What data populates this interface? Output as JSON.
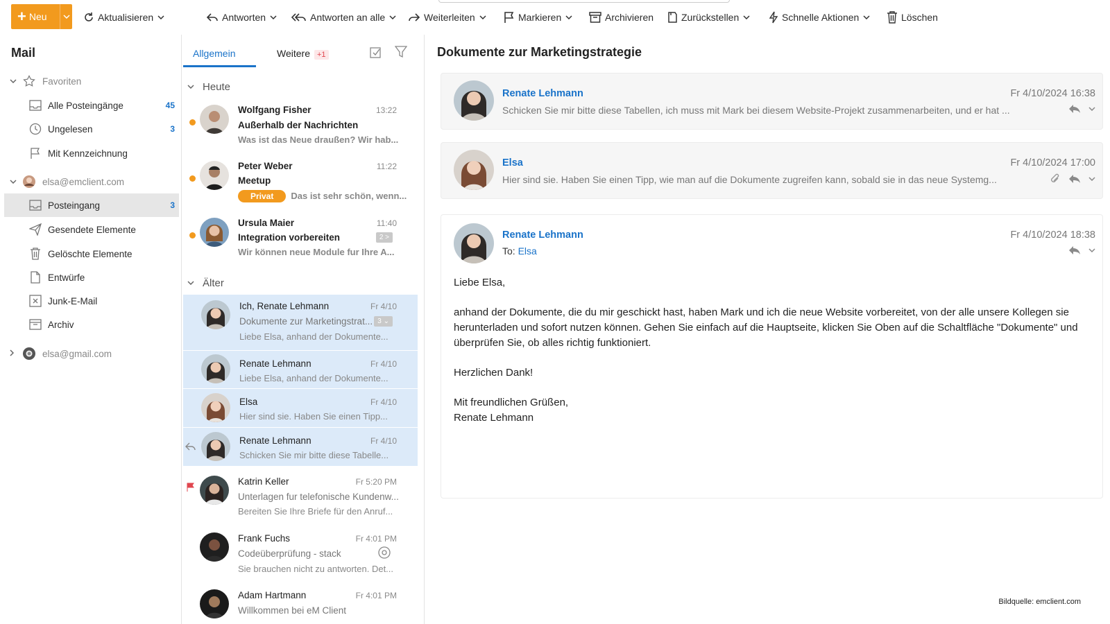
{
  "toolbar": {
    "new_label": "Neu",
    "refresh_label": "Aktualisieren",
    "reply_label": "Antworten",
    "reply_all_label": "Antworten an alle",
    "forward_label": "Weiterleiten",
    "flag_label": "Markieren",
    "archive_label": "Archivieren",
    "snooze_label": "Zurückstellen",
    "quick_actions_label": "Schnelle Aktionen",
    "delete_label": "Löschen"
  },
  "sidebar": {
    "title": "Mail",
    "favorites_label": "Favoriten",
    "all_inboxes_label": "Alle Posteingänge",
    "all_inboxes_count": "45",
    "unread_label": "Ungelesen",
    "unread_count": "3",
    "flagged_label": "Mit Kennzeichnung",
    "account1": "elsa@emclient.com",
    "inbox_label": "Posteingang",
    "inbox_count": "3",
    "sent_label": "Gesendete Elemente",
    "deleted_label": "Gelöschte Elemente",
    "drafts_label": "Entwürfe",
    "junk_label": "Junk-E-Mail",
    "archive_label": "Archiv",
    "account2": "elsa@gmail.com"
  },
  "list": {
    "tab_general": "Allgemein",
    "tab_other": "Weitere",
    "tab_other_badge": "+1",
    "section_today": "Heute",
    "section_older": "Älter",
    "messages": [
      {
        "from": "Wolfgang Fisher",
        "time": "13:22",
        "subject": "Außerhalb der Nachrichten",
        "preview": "Was ist das Neue draußen? Wir hab..."
      },
      {
        "from": "Peter Weber",
        "time": "11:22",
        "subject": "Meetup",
        "tag": "Privat",
        "preview": "Das ist sehr schön, wenn..."
      },
      {
        "from": "Ursula Maier",
        "time": "11:40",
        "subject": "Integration vorbereiten",
        "count": "2 >",
        "preview": "Wir können neue Module fur Ihre A..."
      },
      {
        "from": "Ich, Renate Lehmann",
        "time": "Fr 4/10",
        "subject": "Dokumente zur Marketingstrat...",
        "count": "3 ⌄",
        "preview": "Liebe Elsa, anhand der Dokumente..."
      },
      {
        "from": "Renate Lehmann",
        "time": "Fr 4/10",
        "preview": "Liebe Elsa, anhand der Dokumente..."
      },
      {
        "from": "Elsa",
        "time": "Fr 4/10",
        "preview": "Hier sind sie. Haben Sie einen Tipp..."
      },
      {
        "from": "Renate Lehmann",
        "time": "Fr 4/10",
        "preview": "Schicken Sie mir bitte diese Tabelle..."
      },
      {
        "from": "Katrin Keller",
        "time": "Fr 5:20 PM",
        "subject": "Unterlagen fur telefonische Kundenw...",
        "preview": "Bereiten Sie Ihre Briefe für den Anruf..."
      },
      {
        "from": "Frank Fuchs",
        "time": "Fr 4:01 PM",
        "subject": "Codeüberprüfung - stack",
        "preview": "Sie brauchen nicht zu antworten. Det..."
      },
      {
        "from": "Adam Hartmann",
        "time": "Fr 4:01 PM",
        "subject": "Willkommen bei eM Client"
      }
    ]
  },
  "reader": {
    "title": "Dokumente zur Marketingstrategie",
    "cards": [
      {
        "from": "Renate Lehmann",
        "date": "Fr 4/10/2024 16:38",
        "preview": "Schicken Sie mir bitte diese Tabellen, ich muss mit Mark bei diesem Website-Projekt zusammenarbeiten, und er hat ..."
      },
      {
        "from": "Elsa",
        "date": "Fr 4/10/2024 17:00",
        "preview": "Hier sind sie. Haben Sie einen Tipp, wie man auf die Dokumente zugreifen kann, sobald sie in das neue Systemg..."
      },
      {
        "from": "Renate Lehmann",
        "date": "Fr 4/10/2024 18:38",
        "to_label": "To:",
        "to": "Elsa"
      }
    ],
    "body": {
      "greeting": "Liebe Elsa,",
      "paragraph": "anhand der Dokumente, die du mir geschickt hast, haben Mark und ich die neue Website vorbereitet, von der alle unsere Kollegen sie herunterladen und sofort nutzen können. Gehen Sie einfach auf die Hauptseite, klicken Sie Oben auf die Schaltfläche \"Dokumente\" und überprüfen Sie, ob alles richtig funktioniert.",
      "thanks": "Herzlichen Dank!",
      "closing": "Mit freundlichen Grüßen,",
      "signature": "Renate Lehmann"
    }
  },
  "credit": "Bildquelle: emclient.com",
  "colors": {
    "accent": "#1a73c9",
    "brand": "#f29a1e",
    "selection": "#dceaf9"
  }
}
